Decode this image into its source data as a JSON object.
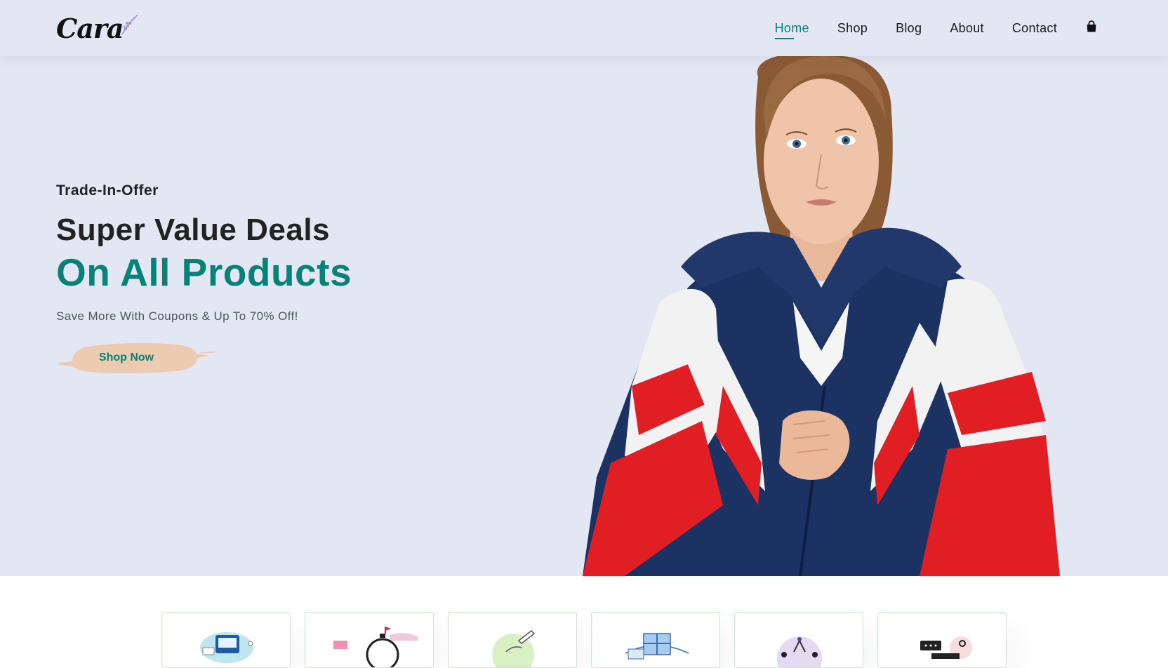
{
  "brand": {
    "name": "Cara"
  },
  "nav": {
    "items": [
      {
        "label": "Home",
        "active": true
      },
      {
        "label": "Shop",
        "active": false
      },
      {
        "label": "Blog",
        "active": false
      },
      {
        "label": "About",
        "active": false
      },
      {
        "label": "Contact",
        "active": false
      }
    ],
    "cart_icon": "shopping-bag-icon"
  },
  "hero": {
    "eyebrow": "Trade-In-Offer",
    "headline": "Super Value Deals",
    "highlight": "On All Products",
    "subtext": "Save More With Coupons & Up To 70% Off!",
    "cta_label": "Shop Now"
  },
  "colors": {
    "accent": "#088178",
    "hero_bg": "#e3e6f3",
    "cta_brush": "#eccbb0",
    "card_border": "#cce7d0"
  },
  "features": [
    {
      "icon": "payments-illustration-icon"
    },
    {
      "icon": "stopwatch-illustration-icon"
    },
    {
      "icon": "green-circle-illustration-icon"
    },
    {
      "icon": "gift-illustration-icon"
    },
    {
      "icon": "people-illustration-icon"
    },
    {
      "icon": "chat-support-illustration-icon"
    }
  ]
}
